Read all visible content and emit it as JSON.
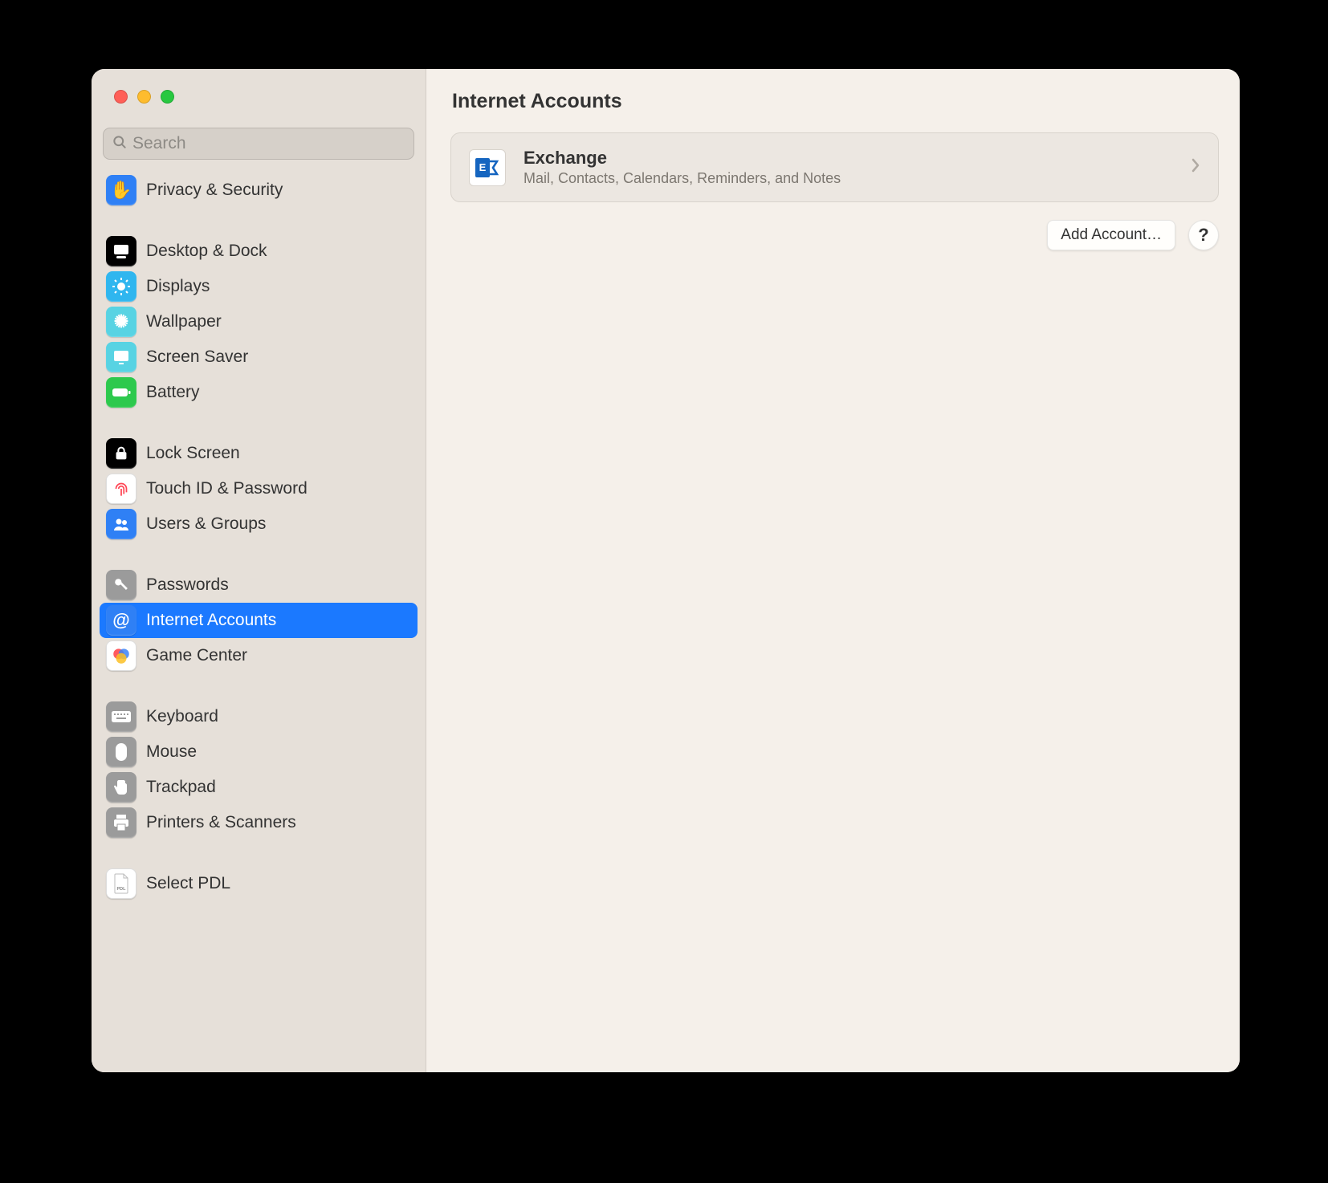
{
  "search": {
    "placeholder": "Search"
  },
  "page": {
    "title": "Internet Accounts"
  },
  "sidebar": {
    "items": [
      {
        "label": "Privacy & Security"
      },
      {
        "label": "Desktop & Dock"
      },
      {
        "label": "Displays"
      },
      {
        "label": "Wallpaper"
      },
      {
        "label": "Screen Saver"
      },
      {
        "label": "Battery"
      },
      {
        "label": "Lock Screen"
      },
      {
        "label": "Touch ID & Password"
      },
      {
        "label": "Users & Groups"
      },
      {
        "label": "Passwords"
      },
      {
        "label": "Internet Accounts"
      },
      {
        "label": "Game Center"
      },
      {
        "label": "Keyboard"
      },
      {
        "label": "Mouse"
      },
      {
        "label": "Trackpad"
      },
      {
        "label": "Printers & Scanners"
      },
      {
        "label": "Select PDL"
      }
    ]
  },
  "account": {
    "title": "Exchange",
    "subtitle": "Mail, Contacts, Calendars, Reminders, and Notes"
  },
  "buttons": {
    "add": "Add Account…",
    "help": "?"
  }
}
